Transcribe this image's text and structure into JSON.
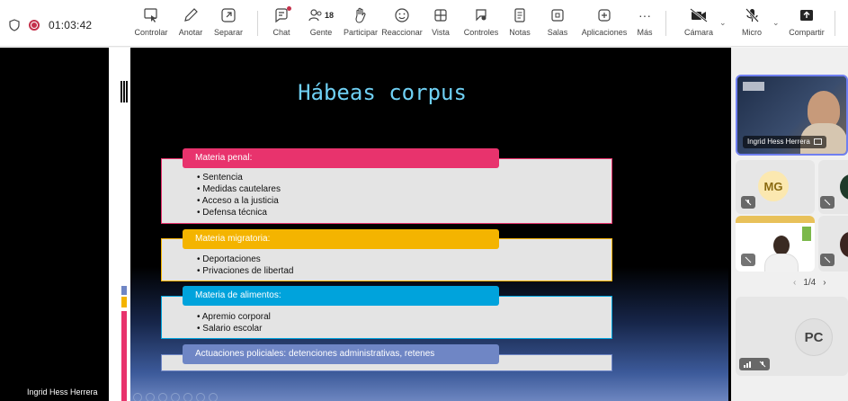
{
  "meeting": {
    "timer": "01:03:42"
  },
  "toolbar": {
    "buttons": [
      {
        "label": "Controlar",
        "icon": "control-icon"
      },
      {
        "label": "Anotar",
        "icon": "pen-icon"
      },
      {
        "label": "Separar",
        "icon": "popout-icon"
      },
      {
        "label": "Chat",
        "icon": "chat-icon"
      },
      {
        "label": "Gente",
        "icon": "people-icon",
        "count": "18"
      },
      {
        "label": "Participar",
        "icon": "raise-hand-icon"
      },
      {
        "label": "Reaccionar",
        "icon": "smiley-icon"
      },
      {
        "label": "Vista",
        "icon": "grid-icon"
      },
      {
        "label": "Controles",
        "icon": "controls-icon"
      },
      {
        "label": "Notas",
        "icon": "notes-icon"
      },
      {
        "label": "Salas",
        "icon": "rooms-icon"
      },
      {
        "label": "Aplicaciones",
        "icon": "add-app-icon"
      },
      {
        "label": "Más",
        "icon": "more-icon",
        "glyph": "···"
      },
      {
        "label": "Cámara",
        "icon": "camera-off-icon"
      },
      {
        "label": "Micro",
        "icon": "mic-off-icon"
      },
      {
        "label": "Compartir",
        "icon": "share-icon"
      }
    ]
  },
  "stage": {
    "speaker_name": "Ingrid Hess Herrera"
  },
  "slide": {
    "title": "Hábeas corpus",
    "sections": [
      {
        "header": "Materia penal:",
        "color": "#e8336d",
        "items": [
          "Sentencia",
          "Medidas cautelares",
          "Acceso a la justicia",
          "Defensa técnica"
        ]
      },
      {
        "header": "Materia migratoria:",
        "color": "#f4b400",
        "items": [
          "Deportaciones",
          "Privaciones de libertad"
        ]
      },
      {
        "header": "Materia de alimentos:",
        "color": "#00a3dc",
        "items": [
          "Apremio corporal",
          "Salario escolar"
        ]
      },
      {
        "header": "Actuaciones policiales: detenciones administrativas, retenes",
        "color": "#6f86c5",
        "items": []
      }
    ]
  },
  "participants": {
    "featured_name": "Ingrid Hess Herrera",
    "mg_initials": "MG",
    "pc_initials": "PC",
    "pager": "1/4"
  },
  "colors": {
    "title": "#6fd0f4",
    "record": "#c4314b"
  }
}
